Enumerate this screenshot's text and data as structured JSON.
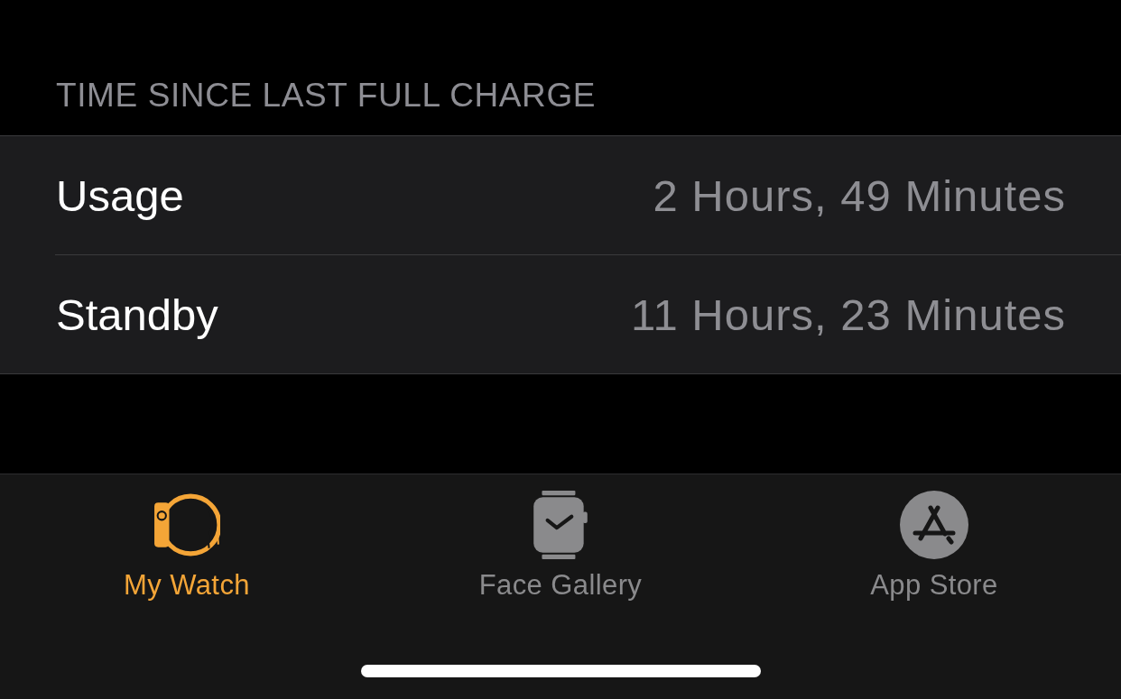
{
  "section_header": "TIME SINCE LAST FULL CHARGE",
  "rows": [
    {
      "label": "Usage",
      "value": "2 Hours, 49 Minutes"
    },
    {
      "label": "Standby",
      "value": "11 Hours, 23 Minutes"
    }
  ],
  "tab_bar": {
    "tabs": [
      {
        "kind": "my-watch",
        "label": "My Watch",
        "selected": true
      },
      {
        "kind": "face-gallery",
        "label": "Face Gallery",
        "selected": false
      },
      {
        "kind": "app-store",
        "label": "App Store",
        "selected": false
      }
    ]
  }
}
